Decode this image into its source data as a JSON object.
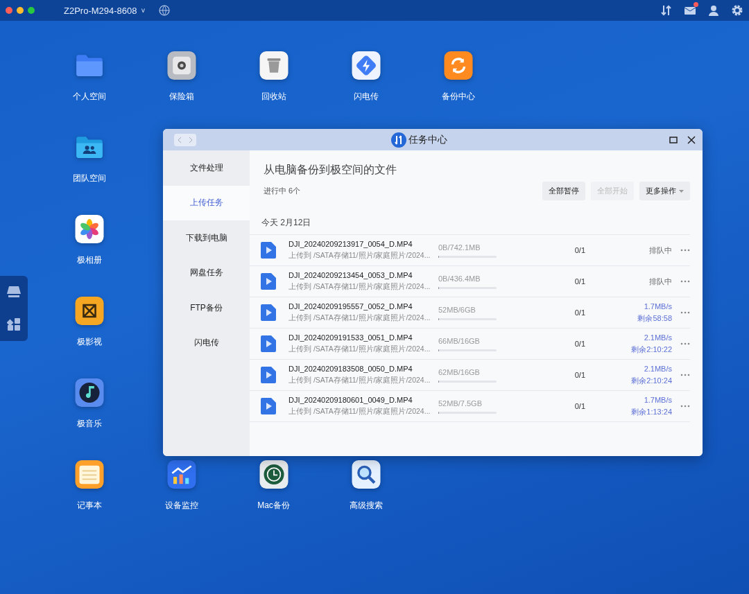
{
  "top_bar": {
    "device_name": "Z2Pro-M294-8608",
    "caret": "˅",
    "mail_unread": true
  },
  "desktop": {
    "top_row": [
      {
        "label": "个人空间"
      },
      {
        "label": "保险箱"
      },
      {
        "label": "回收站"
      },
      {
        "label": "闪电传"
      },
      {
        "label": "备份中心"
      }
    ],
    "left_column": [
      {
        "label": "团队空间"
      },
      {
        "label": "极相册"
      },
      {
        "label": "极影视"
      },
      {
        "label": "极音乐"
      }
    ],
    "bottom_row": [
      {
        "label": "记事本"
      },
      {
        "label": "设备监控"
      },
      {
        "label": "Mac备份"
      },
      {
        "label": "高级搜索"
      }
    ]
  },
  "window": {
    "title": "任务中心",
    "sidebar": [
      {
        "label": "文件处理",
        "selected": false
      },
      {
        "label": "上传任务",
        "selected": true
      },
      {
        "label": "下载到电脑",
        "selected": false
      },
      {
        "label": "网盘任务",
        "selected": false
      },
      {
        "label": "FTP备份",
        "selected": false
      },
      {
        "label": "闪电传",
        "selected": false
      }
    ],
    "heading": "从电脑备份到极空间的文件",
    "summary": "进行中 6个",
    "buttons": [
      {
        "label": "全部暂停",
        "disabled": false
      },
      {
        "label": "全部开始",
        "disabled": true
      },
      {
        "label": "更多操作",
        "disabled": false
      }
    ],
    "date": "今天 2月12日",
    "tasks": [
      {
        "name": "DJI_20240209213917_0054_D.MP4",
        "dest": "上传到 /SATA存储11/照片/家庭照片/2024...",
        "size": "0B/742.1MB",
        "level": 0,
        "count": "0/1",
        "kind": "queued",
        "status": "排队中"
      },
      {
        "name": "DJI_20240209213454_0053_D.MP4",
        "dest": "上传到 /SATA存储11/照片/家庭照片/2024...",
        "size": "0B/436.4MB",
        "level": 0,
        "count": "0/1",
        "kind": "queued",
        "status": "排队中"
      },
      {
        "name": "DJI_20240209195557_0052_D.MP4",
        "dest": "上传到 /SATA存储11/照片/家庭照片/2024...",
        "size": "52MB/6GB",
        "level": 0.01,
        "count": "0/1",
        "kind": "active",
        "speed": "1.7MB/s",
        "remaining": "剩余58:58"
      },
      {
        "name": "DJI_20240209191533_0051_D.MP4",
        "dest": "上传到 /SATA存储11/照片/家庭照片/2024...",
        "size": "66MB/16GB",
        "level": 0.01,
        "count": "0/1",
        "kind": "active",
        "speed": "2.1MB/s",
        "remaining": "剩余2:10:22"
      },
      {
        "name": "DJI_20240209183508_0050_D.MP4",
        "dest": "上传到 /SATA存储11/照片/家庭照片/2024...",
        "size": "62MB/16GB",
        "level": 0.01,
        "count": "0/1",
        "kind": "active",
        "speed": "2.1MB/s",
        "remaining": "剩余2:10:24"
      },
      {
        "name": "DJI_20240209180601_0049_D.MP4",
        "dest": "上传到 /SATA存储11/照片/家庭照片/2024...",
        "size": "52MB/7.5GB",
        "level": 0.01,
        "count": "0/1",
        "kind": "active",
        "speed": "1.7MB/s",
        "remaining": "剩余1:13:24"
      }
    ]
  }
}
